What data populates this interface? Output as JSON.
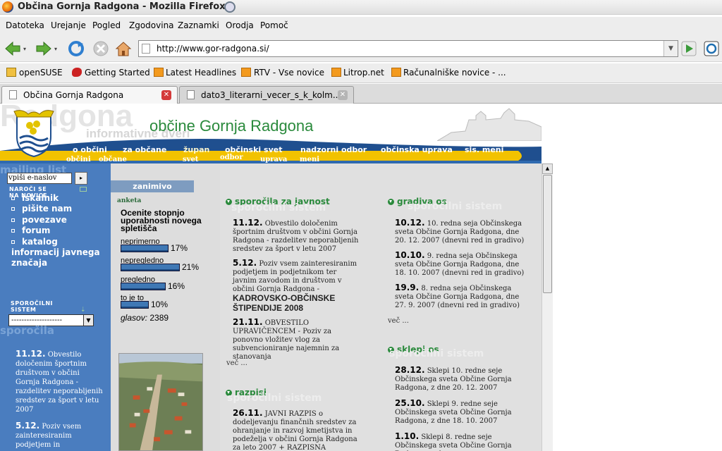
{
  "window": {
    "title": "Občina Gornja Radgona - Mozilla Firefox"
  },
  "menu": [
    "Datoteka",
    "Urejanje",
    "Pogled",
    "Zgodovina",
    "Zaznamki",
    "Orodja",
    "Pomoč"
  ],
  "address": {
    "url": "http://www.gor-radgona.si/"
  },
  "bookmarks": [
    "openSUSE",
    "Getting Started",
    "Latest Headlines",
    "RTV - Vse novice",
    "Litrop.net",
    "Računalniške novice - ..."
  ],
  "tabs": [
    {
      "label": "Občina Gornja Radgona",
      "active": true
    },
    {
      "label": "dato3_literarni_vecer_s_k_kolm...",
      "active": false
    }
  ],
  "site": {
    "ghost_top": "Radgona",
    "ghost_sub": "informativne dveri",
    "title": "občine Gornja Radgona",
    "nav_top": [
      "o občini",
      "za občane",
      "župan",
      "občinski svet",
      "nadzorni odbor",
      "občinska uprava",
      "sis. meni"
    ],
    "nav_bottom": [
      "občini",
      "občane",
      "svet",
      "odbor",
      "uprava",
      "meni"
    ],
    "nav_overlap": [
      "za občane",
      "župan",
      "občinski svet",
      "občinska"
    ]
  },
  "left": {
    "mailing_ghost": "mailing list",
    "email_placeholder": "vpiši e-naslov",
    "email_btn": "▸",
    "naroc_label": "NAROČI SE NA NOVICE",
    "links": [
      "iskalnik",
      "pišite nam",
      "povezave",
      "forum",
      "katalog informacij javnega značaja"
    ],
    "sporocila_label": "SPOROČILNI SISTEM",
    "select_value": "--------------------",
    "sporocila_ghost": "sporočila",
    "news": [
      {
        "date": "11.12.",
        "text": "Obvestilo določenim športnim društvom v občini Gornja Radgona - razdelitev neporabljenih sredstev za šport v letu 2007"
      },
      {
        "date": "5.12.",
        "text": "Poziv vsem zainteresiranim podjetjem in"
      }
    ]
  },
  "poll": {
    "tab": "zanimivo",
    "label": "anketa",
    "question": "Ocenite stopnjo uporabnosti novega spletišča",
    "options": [
      {
        "label": "neprimerno",
        "percent": 17,
        "pct_text": "17%"
      },
      {
        "label": "nepregledno",
        "percent": 21,
        "pct_text": "21%"
      },
      {
        "label": "pregledno",
        "percent": 16,
        "pct_text": "16%"
      },
      {
        "label": "to je to",
        "percent": 10,
        "pct_text": "10%"
      }
    ],
    "votes_label": "glasov:",
    "votes": "2389"
  },
  "sporocila": {
    "heading": "sporočila za javnost",
    "ghost": "sporočilni sistem",
    "items": [
      {
        "date": "11.12.",
        "text": "Obvestilo določenim športnim društvom v občini Gornja Radgona - razdelitev neporabljenih sredstev za šport v letu 2007"
      },
      {
        "date": "5.12.",
        "text": "Poziv vsem zainteresiranim podjetjem in podjetnikom ter javnim zavodom in društvom v občini Gornja Radgona -",
        "caps": "KADROVSKO-OBČINSKE ŠTIPENDIJE 2008"
      },
      {
        "date": "21.11.",
        "text": "OBVESTILO UPRAVIČENCEM - Poziv za ponovno vložitev vlog za subvencioniranje najemnin za stanovanja"
      }
    ],
    "more": "več ..."
  },
  "razpisi": {
    "heading": "razpisi",
    "ghost": "sporočilni sistem",
    "items": [
      {
        "date": "26.11.",
        "text": "JAVNI RAZPIS o dodeljevanju finančnih sredstev za ohranjanje in razvoj kmetijstva in podeželja v občini Gornja Radgona za leto 2007 + RAZPISNA DOKUMENTACIJA"
      }
    ]
  },
  "gradiva": {
    "heading": "gradiva os",
    "ghost": "sporočilni sistem",
    "items": [
      {
        "date": "10.12.",
        "text": "10. redna seja Občinskega sveta Občine Gornja Radgona, dne 20. 12. 2007 (dnevni red in gradivo)"
      },
      {
        "date": "10.10.",
        "text": "9. redna seja Občinskega sveta Občine Gornja Radgona, dne 18. 10. 2007 (dnevni red in gradivo)"
      },
      {
        "date": "19.9.",
        "text": "8. redna seja Občinskega sveta Občine Gornja Radgona, dne 27. 9. 2007 (dnevni red in gradivo)"
      }
    ],
    "more": "več ..."
  },
  "sklepi": {
    "heading": "sklepi os",
    "ghost": "sporočilni sistem",
    "items": [
      {
        "date": "28.12.",
        "text": "Sklepi 10. redne seje Občinskega sveta Občine Gornja Radgona, z dne 20. 12. 2007"
      },
      {
        "date": "25.10.",
        "text": "Sklepi 9. redne seje Občinskega sveta Občine Gornja Radgona, z dne 18. 10. 2007"
      },
      {
        "date": "1.10.",
        "text": "Sklepi 8. redne seje Občinskega sveta Občine Gornja Radgona, z dne"
      }
    ]
  },
  "colors": {
    "green": "#2a8a3c",
    "blue": "#4a7dbf",
    "yellow": "#f2c200",
    "navy": "#1f4f8f"
  }
}
